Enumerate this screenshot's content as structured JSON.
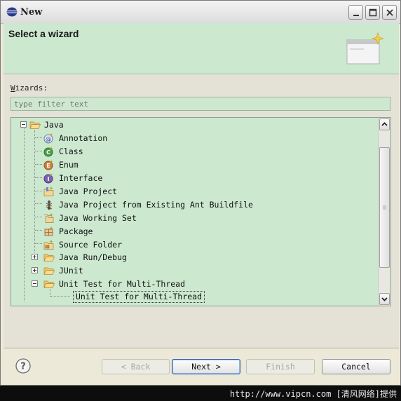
{
  "window": {
    "title": "New"
  },
  "banner": {
    "title": "Select a wizard",
    "image_icon": "wizard-banner-icon"
  },
  "wizards": {
    "label_mnemonic": "W",
    "label_rest": "izards:"
  },
  "filter": {
    "placeholder": "type filter text",
    "value": ""
  },
  "tree": {
    "items": [
      {
        "label": "Java",
        "icon": "folder-open-icon",
        "expanded": true
      },
      {
        "label": "Annotation",
        "icon": "annotation-icon"
      },
      {
        "label": "Class",
        "icon": "class-icon"
      },
      {
        "label": "Enum",
        "icon": "enum-icon"
      },
      {
        "label": "Interface",
        "icon": "interface-icon"
      },
      {
        "label": "Java Project",
        "icon": "java-project-icon"
      },
      {
        "label": "Java Project from Existing Ant Buildfile",
        "icon": "ant-icon"
      },
      {
        "label": "Java Working Set",
        "icon": "working-set-icon"
      },
      {
        "label": "Package",
        "icon": "package-icon"
      },
      {
        "label": "Source Folder",
        "icon": "source-folder-icon"
      },
      {
        "label": "Java Run/Debug",
        "icon": "folder-icon",
        "expanded": false
      },
      {
        "label": "JUnit",
        "icon": "folder-icon",
        "expanded": false
      },
      {
        "label": "Unit Test for Multi-Thread",
        "icon": "folder-open-icon",
        "expanded": true
      },
      {
        "label": "Unit Test for Multi-Thread",
        "selected": true
      }
    ]
  },
  "buttons": {
    "back": "< Back",
    "next": "Next >",
    "finish": "Finish",
    "cancel": "Cancel"
  },
  "watermark": "http://www.vipcn.com [清风网络]提供",
  "colors": {
    "panel_green": "#cce8cf",
    "dialog_bg": "#ece9d8"
  }
}
